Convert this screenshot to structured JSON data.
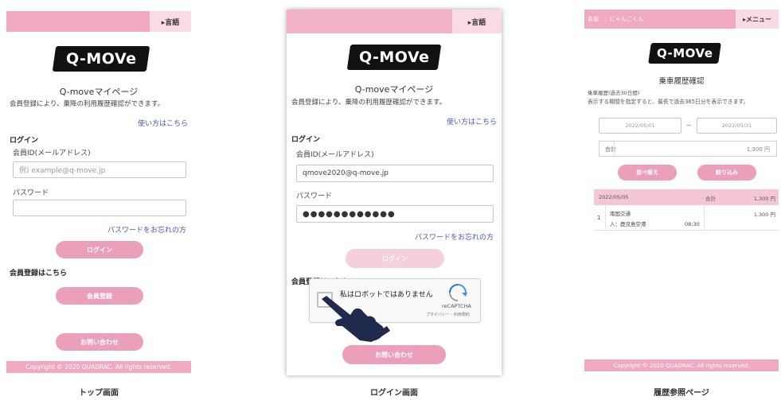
{
  "panels": {
    "top": {
      "lang_button": "▸言語",
      "logo": "Q-MOVe",
      "title": "Q-moveマイページ",
      "subtitle": "会員登録により、乗降の利用履歴確認ができます。",
      "howto_link": "使い方はこちら",
      "login_heading": "ログイン",
      "member_id_label": "会員ID(メールアドレス)",
      "member_id_placeholder": "例) example@q-move.jp",
      "password_label": "パスワード",
      "forgot_link": "パスワードをお忘れの方",
      "login_button": "ログイン",
      "register_heading": "会員登録はこちら",
      "register_button": "会員登録",
      "contact_button": "お問い合わせ",
      "footer": "Copyright © 2020 QUADRAC. All rights reserved.",
      "caption": "トップ画面"
    },
    "login": {
      "lang_button": "▸言語",
      "logo": "Q-MOVe",
      "title": "Q-moveマイページ",
      "subtitle": "会員登録により、乗降の利用履歴確認ができます。",
      "howto_link": "使い方はこちら",
      "login_heading": "ログイン",
      "member_id_label": "会員ID(メールアドレス)",
      "member_id_value": "qmove2020@q-move.jp",
      "password_label": "パスワード",
      "password_value": "●●●●●●●●●●●●",
      "forgot_link": "パスワードをお忘れの方",
      "login_button": "ログイン",
      "register_heading": "会員登録はこちら",
      "captcha_text": "私はロボットではありません",
      "captcha_brand": "reCAPTCHA",
      "captcha_links": "プライバシー - 利用規約",
      "contact_button": "お問い合わせ",
      "caption": "ログイン画面"
    },
    "history": {
      "user_label": "名前　：にゃんごくん",
      "menu_button": "▸メニュー",
      "logo": "Q-MOVe",
      "title": "乗車履歴確認",
      "period_note": "乗車履歴(過去30日間)",
      "period_desc": "表示する期間を指定すると、最長で過去365日分を表示できます。",
      "date_from": "2022/05/01",
      "date_sep": "~",
      "date_to": "2022/05/31",
      "total_label": "合計",
      "total_value": "1,300 円",
      "sort_button": "並べ替え",
      "filter_button": "絞り込み",
      "row_date": "2022/05/05",
      "row_total_label": "合計",
      "row_total_value": "1,300 円",
      "item_no": "1",
      "item_company": "南国交通",
      "item_stop": "入：鹿児島空港",
      "item_time": "08:30",
      "item_fare": "1,300 円",
      "footer": "Copyright © 2020 QUADRAC. All rights reserved.",
      "caption": "履歴参照ページ"
    }
  },
  "colors": {
    "header_pink": "#f0a9c1",
    "button_pink": "#ec9fbb",
    "light_pink": "#f9dbe6",
    "link_blue": "#4a56b8"
  }
}
